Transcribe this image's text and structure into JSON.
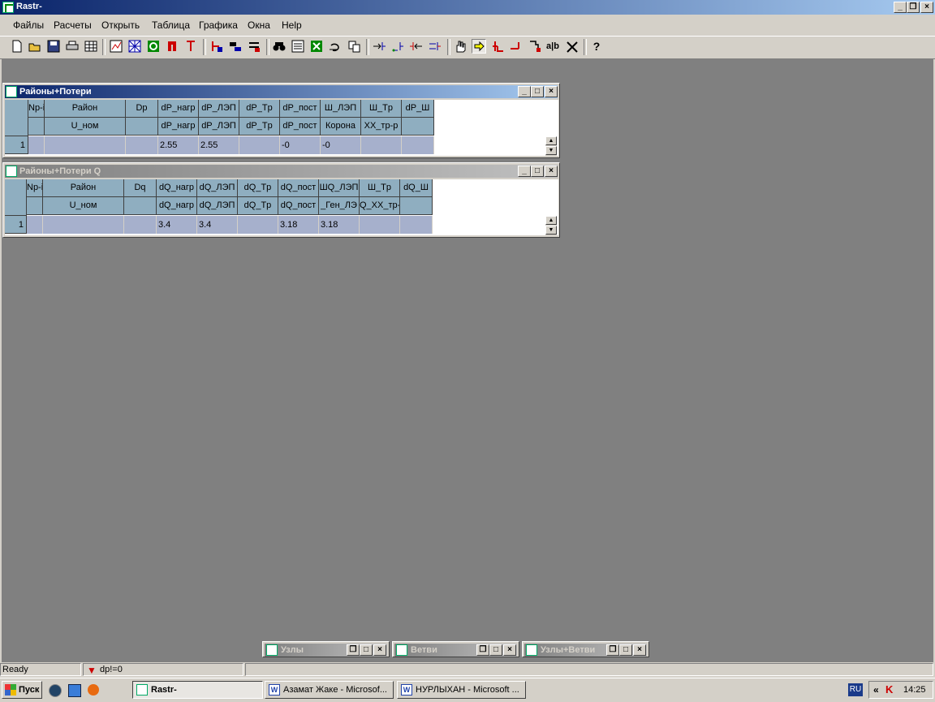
{
  "window": {
    "title": "Rastr-"
  },
  "menu": [
    "Файлы",
    "Расчеты",
    "Открыть",
    "Таблица",
    "Графика",
    "Окна",
    "Help"
  ],
  "toolbar_icons": [
    "new-icon",
    "open-icon",
    "save-icon",
    "print-icon",
    "table-icon",
    "graph-icon",
    "grid-icon",
    "refresh-icon",
    "magnet-icon",
    "arrow-down-icon",
    "tool-1-icon",
    "tool-2-icon",
    "tool-3-icon",
    "binoculars-icon",
    "list-icon",
    "excel-icon",
    "undo-icon",
    "copy-icon",
    "link-1-icon",
    "link-2-icon",
    "link-3-icon",
    "link-4-icon",
    "hand-icon",
    "pointer-icon",
    "node-icon",
    "branch-icon",
    "cursor-icon",
    "ab-label-icon",
    "scissors-icon",
    "help-icon"
  ],
  "windows": [
    {
      "title": "Районы+Потери",
      "active": true,
      "header_row1": [
        "Np-i",
        "Район",
        "Dp",
        "dP_нагр",
        "dP_ЛЭП",
        "dP_Tp",
        "dP_пост",
        "Ш_ЛЭП",
        "Ш_Tp",
        "dP_Ш"
      ],
      "header_row2": [
        "",
        "U_ном",
        "",
        "dP_нагр",
        "dP_ЛЭП",
        "dP_Tp",
        "dP_пост",
        "Корона",
        "XX_тр-р",
        ""
      ],
      "rows": [
        {
          "num": "1",
          "cells": [
            "",
            "",
            "",
            "2.55",
            "2.55",
            "",
            "-0",
            "-0",
            "",
            ""
          ]
        }
      ]
    },
    {
      "title": "Районы+Потери Q",
      "active": false,
      "header_row1": [
        "Np-i",
        "Район",
        "Dq",
        "dQ_нагр",
        "dQ_ЛЭП",
        "dQ_Tp",
        "dQ_пост",
        "ШQ_ЛЭП",
        "Ш_Tp",
        "dQ_Ш"
      ],
      "header_row2": [
        "",
        "U_ном",
        "",
        "dQ_нагр",
        "dQ_ЛЭП",
        "dQ_Tp",
        "dQ_пост",
        "_Ген_ЛЭ",
        "Q_XX_тр-р",
        ""
      ],
      "rows": [
        {
          "num": "1",
          "cells": [
            "",
            "",
            "",
            "3.4",
            "3.4",
            "",
            "3.18",
            "3.18",
            "",
            ""
          ]
        }
      ]
    }
  ],
  "minimized": [
    "Узлы",
    "Ветви",
    "Узлы+Ветви"
  ],
  "status": {
    "ready": "Ready",
    "filter": "dp!=0"
  },
  "taskbar": {
    "start": "Пуск",
    "tasks": [
      "Rastr-",
      "Азамат Жаке - Microsof...",
      "НУРЛЫХАН - Microsoft ..."
    ],
    "lang": "RU",
    "time": "14:25"
  },
  "colors": {
    "title_active": "#0a246a",
    "header_cell": "#8faec0",
    "data_cell": "#a6b0cc",
    "desktop": "#808080"
  }
}
